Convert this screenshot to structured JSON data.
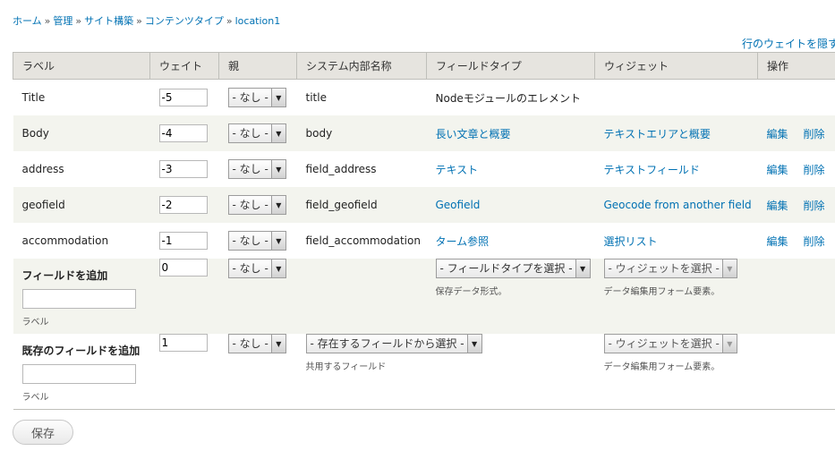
{
  "breadcrumb": [
    "ホーム",
    "管理",
    "サイト構築",
    "コンテンツタイプ",
    "location1"
  ],
  "breadcrumb_sep": "»",
  "toggle_weights": "行のウェイトを隠す",
  "headers": [
    "ラベル",
    "ウェイト",
    "親",
    "システム内部名称",
    "フィールドタイプ",
    "ウィジェット",
    "操作"
  ],
  "rows": [
    {
      "label": "Title",
      "weight": "-5",
      "parent": "- なし -",
      "machine": "title",
      "type": "Nodeモジュールのエレメント",
      "widget": "",
      "edit": "",
      "delete": ""
    },
    {
      "label": "Body",
      "weight": "-4",
      "parent": "- なし -",
      "machine": "body",
      "type": "長い文章と概要",
      "widget": "テキストエリアと概要",
      "edit": "編集",
      "delete": "削除"
    },
    {
      "label": "address",
      "weight": "-3",
      "parent": "- なし -",
      "machine": "field_address",
      "type": "テキスト",
      "widget": "テキストフィールド",
      "edit": "編集",
      "delete": "削除"
    },
    {
      "label": "geofield",
      "weight": "-2",
      "parent": "- なし -",
      "machine": "field_geofield",
      "type": "Geofield",
      "widget": "Geocode from another field",
      "edit": "編集",
      "delete": "削除"
    },
    {
      "label": "accommodation",
      "weight": "-1",
      "parent": "- なし -",
      "machine": "field_accommodation",
      "type": "ターム参照",
      "widget": "選択リスト",
      "edit": "編集",
      "delete": "削除"
    }
  ],
  "add_new": {
    "title": "フィールドを追加",
    "label_value": "",
    "label_desc": "ラベル",
    "weight": "0",
    "parent": "- なし -",
    "type_select": "- フィールドタイプを選択 -",
    "type_desc": "保存データ形式。",
    "widget_select": "- ウィジェットを選択 -",
    "widget_desc": "データ編集用フォーム要素。"
  },
  "add_existing": {
    "title": "既存のフィールドを追加",
    "label_value": "",
    "label_desc": "ラベル",
    "weight": "1",
    "parent": "- なし -",
    "field_select": "- 存在するフィールドから選択 -",
    "field_desc": "共用するフィールド",
    "widget_select": "- ウィジェットを選択 -",
    "widget_desc": "データ編集用フォーム要素。"
  },
  "save_label": "保存",
  "colors": {
    "link": "#0071b3",
    "header_bg": "#e6e4df",
    "stripe_bg": "#f3f4ee"
  }
}
